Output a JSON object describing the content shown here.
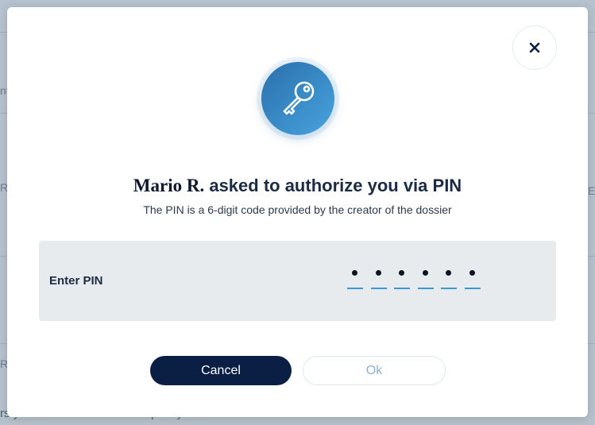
{
  "dialog": {
    "requester_name": "Mario R.",
    "title_rest": " asked to authorize you via PIN",
    "subtitle": "The PIN is a 6-digit code provided by the creator of the dossier",
    "pin_label": "Enter PIN",
    "pin_length": 6,
    "pin_filled_count": 6,
    "cancel_label": "Cancel",
    "ok_label": "Ok",
    "close_icon": "close-icon",
    "key_icon": "key-icon"
  },
  "background": {
    "fragments": [
      "nt",
      "R",
      "E",
      "R"
    ],
    "bottom_text": "rs you have received that require your attention"
  },
  "colors": {
    "accent": "#3a98d6",
    "primary_button": "#0b1f45",
    "panel": "#e7ebee"
  }
}
